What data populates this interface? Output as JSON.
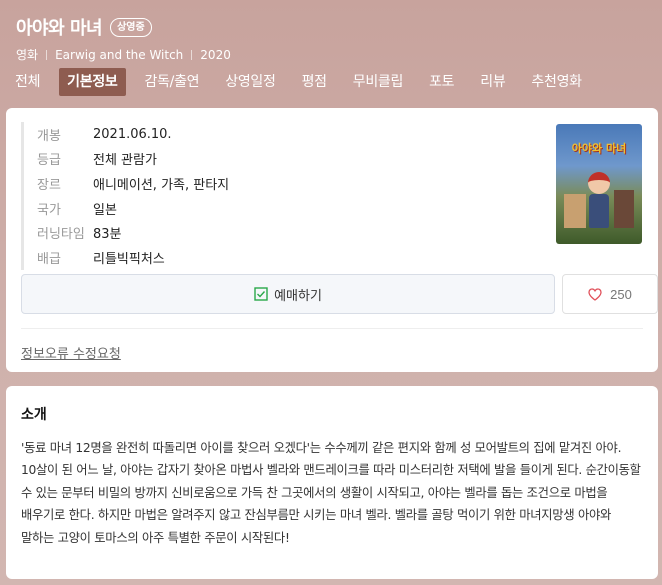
{
  "header": {
    "title": "아야와 마녀",
    "status_badge": "상영중",
    "meta": [
      "영화",
      "Earwig and the Witch",
      "2020"
    ]
  },
  "tabs": [
    {
      "label": "전체",
      "active": false
    },
    {
      "label": "기본정보",
      "active": true
    },
    {
      "label": "감독/출연",
      "active": false
    },
    {
      "label": "상영일정",
      "active": false
    },
    {
      "label": "평점",
      "active": false
    },
    {
      "label": "무비클립",
      "active": false
    },
    {
      "label": "포토",
      "active": false
    },
    {
      "label": "리뷰",
      "active": false
    },
    {
      "label": "추천영화",
      "active": false
    }
  ],
  "info": [
    {
      "key": "개봉",
      "value": "2021.06.10."
    },
    {
      "key": "등급",
      "value": "전체 관람가"
    },
    {
      "key": "장르",
      "value": "애니메이션, 가족, 판타지"
    },
    {
      "key": "국가",
      "value": "일본"
    },
    {
      "key": "러닝타임",
      "value": "83분"
    },
    {
      "key": "배급",
      "value": "리틀빅픽처스"
    }
  ],
  "poster": {
    "title_text": "아야와 마녀"
  },
  "actions": {
    "reserve_label": "예매하기",
    "like_count": "250"
  },
  "report_link": "정보오류 수정요청",
  "intro": {
    "title": "소개",
    "text": "'동료 마녀 12명을 완전히 따돌리면 아이를 찾으러 오겠다'는 수수께끼 같은 편지와 함께 성 모어발트의 집에 맡겨진 아야. 10살이 된 어느 날, 아야는 갑자기 찾아온 마법사 벨라와 맨드레이크를 따라 미스터리한 저택에 발을 들이게 된다. 순간이동할 수 있는 문부터 비밀의 방까지 신비로움으로 가득 찬 그곳에서의 생활이 시작되고, 아야는 벨라를 돕는 조건으로 마법을 배우기로 한다. 하지만 마법은 알려주지 않고 잔심부름만 시키는 마녀 벨라. 벨라를 골탕 먹이기 위한 마녀지망생 아야와 말하는 고양이 토마스의 아주 특별한 주문이 시작된다!"
  },
  "colors": {
    "header_bg": "#c8a39d",
    "active_tab": "#8e5c50",
    "heart": "#e0505a",
    "check": "#2aa84a"
  }
}
